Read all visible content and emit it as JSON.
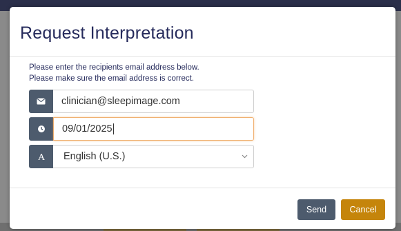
{
  "modal": {
    "title": "Request Interpretation",
    "instructions": [
      "Please enter the recipients email address below.",
      "Please make sure the email address is correct."
    ],
    "email": {
      "value": "clinician@sleepimage.com",
      "icon": "envelope-icon"
    },
    "date": {
      "value": "09/01/2025",
      "icon": "clock-icon"
    },
    "language": {
      "selected": "English (U.S.)",
      "icon": "letter-a-icon"
    },
    "buttons": {
      "send": "Send",
      "cancel": "Cancel"
    }
  },
  "colors": {
    "title": "#262b5c",
    "addon": "#4d5b6d",
    "send": "#4d5b6d",
    "cancel": "#c5850b",
    "focus_border": "#f0b070"
  }
}
